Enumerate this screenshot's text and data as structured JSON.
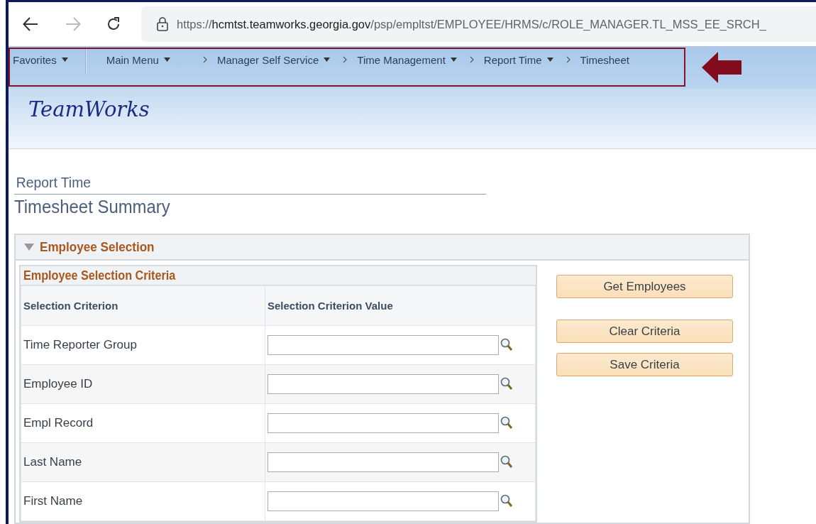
{
  "browser": {
    "url": "https://**hcmtst.teamworks.georgia.gov**/psp/empltst/EMPLOYEE/HRMS/c/ROLE_MANAGER.TL_MSS_EE_SRCH_"
  },
  "nav": {
    "favorites": {
      "label": "Favorites",
      "dropdown": true
    },
    "breadcrumbs": [
      {
        "label": "Main Menu",
        "dropdown": true
      },
      {
        "label": "Manager Self Service",
        "dropdown": true
      },
      {
        "label": "Time Management",
        "dropdown": true
      },
      {
        "label": "Report Time",
        "dropdown": true
      },
      {
        "label": "Timesheet",
        "dropdown": false
      }
    ]
  },
  "header": {
    "logo": "TeamWorks"
  },
  "page": {
    "breadcrumb_title": "Report Time",
    "title": "Timesheet Summary"
  },
  "section": {
    "title": "Employee Selection",
    "expanded": true,
    "grid": {
      "title": "Employee Selection Criteria",
      "columns": [
        "Selection Criterion",
        "Selection Criterion Value"
      ],
      "rows": [
        {
          "label": "Time Reporter Group"
        },
        {
          "label": "Employee ID"
        },
        {
          "label": "Empl Record"
        },
        {
          "label": "Last Name"
        },
        {
          "label": "First Name"
        }
      ]
    },
    "buttons": [
      "Get Employees",
      "Clear Criteria",
      "Save Criteria"
    ]
  }
}
